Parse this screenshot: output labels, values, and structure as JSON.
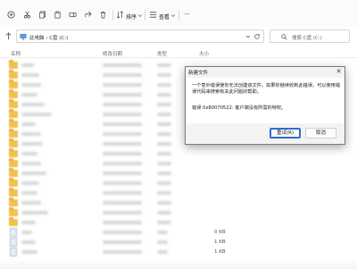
{
  "toolbar": {
    "sort_label": "排序",
    "view_label": "查看",
    "more_label": "···"
  },
  "address": {
    "path": "此电脑 › C盘 (C:)",
    "search_placeholder": "搜索 C盘 (C:)"
  },
  "columns": {
    "name": "名称",
    "modified": "修改日期",
    "type": "类型",
    "size": "大小"
  },
  "files": [
    {
      "kind": "folder",
      "size": ""
    },
    {
      "kind": "folder",
      "size": ""
    },
    {
      "kind": "folder",
      "size": ""
    },
    {
      "kind": "folder",
      "size": ""
    },
    {
      "kind": "folder",
      "size": ""
    },
    {
      "kind": "folder",
      "size": ""
    },
    {
      "kind": "folder",
      "size": ""
    },
    {
      "kind": "folder",
      "size": ""
    },
    {
      "kind": "folder",
      "size": ""
    },
    {
      "kind": "folder",
      "size": ""
    },
    {
      "kind": "folder",
      "size": ""
    },
    {
      "kind": "folder",
      "size": ""
    },
    {
      "kind": "folder",
      "size": ""
    },
    {
      "kind": "folder",
      "size": ""
    },
    {
      "kind": "folder",
      "size": ""
    },
    {
      "kind": "folder",
      "size": ""
    },
    {
      "kind": "folder",
      "size": ""
    },
    {
      "kind": "file",
      "size": "0 KB"
    },
    {
      "kind": "file",
      "size": "1 KB"
    },
    {
      "kind": "file",
      "size": "1 KB"
    }
  ],
  "dialog": {
    "title": "新建文件",
    "close_glyph": "✕",
    "message": "一个意外错误使你无法创建该文件。如果你继续收到此错误，可以使用错误代码来搜索有关此问题的帮助。",
    "error": "错误 0x80070522: 客户端没有所需的特权。",
    "retry_label": "重试(R)",
    "cancel_label": "取消"
  },
  "colors": {
    "folder": "#f2c14e",
    "accent": "#2e6bd1"
  }
}
